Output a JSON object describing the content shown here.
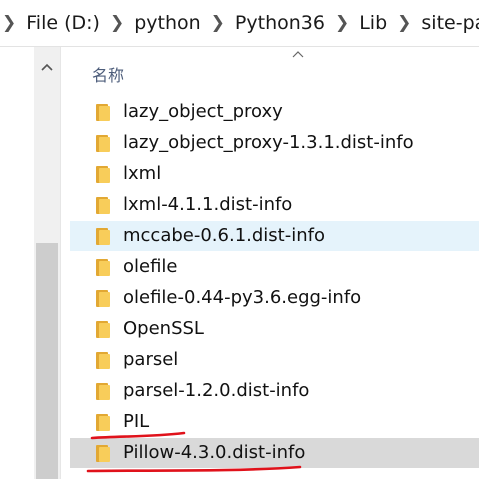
{
  "address": {
    "crumbs": [
      "File (D:)",
      "python",
      "Python36",
      "Lib",
      "site-packag"
    ]
  },
  "nav": {
    "scroll_up_icon": "chevron-up-icon"
  },
  "list": {
    "column_name": "名称",
    "sort_icon": "chevron-up-icon",
    "rows": [
      {
        "label": "lazy_object_proxy",
        "state": "normal"
      },
      {
        "label": "lazy_object_proxy-1.3.1.dist-info",
        "state": "normal"
      },
      {
        "label": "lxml",
        "state": "normal"
      },
      {
        "label": "lxml-4.1.1.dist-info",
        "state": "normal"
      },
      {
        "label": "mccabe-0.6.1.dist-info",
        "state": "hover"
      },
      {
        "label": "olefile",
        "state": "normal"
      },
      {
        "label": "olefile-0.44-py3.6.egg-info",
        "state": "normal"
      },
      {
        "label": "OpenSSL",
        "state": "normal"
      },
      {
        "label": "parsel",
        "state": "normal"
      },
      {
        "label": "parsel-1.2.0.dist-info",
        "state": "normal"
      },
      {
        "label": "PIL",
        "state": "normal"
      },
      {
        "label": "Pillow-4.3.0.dist-info",
        "state": "selected"
      }
    ]
  },
  "annotation": {
    "color": "#e0121b"
  }
}
